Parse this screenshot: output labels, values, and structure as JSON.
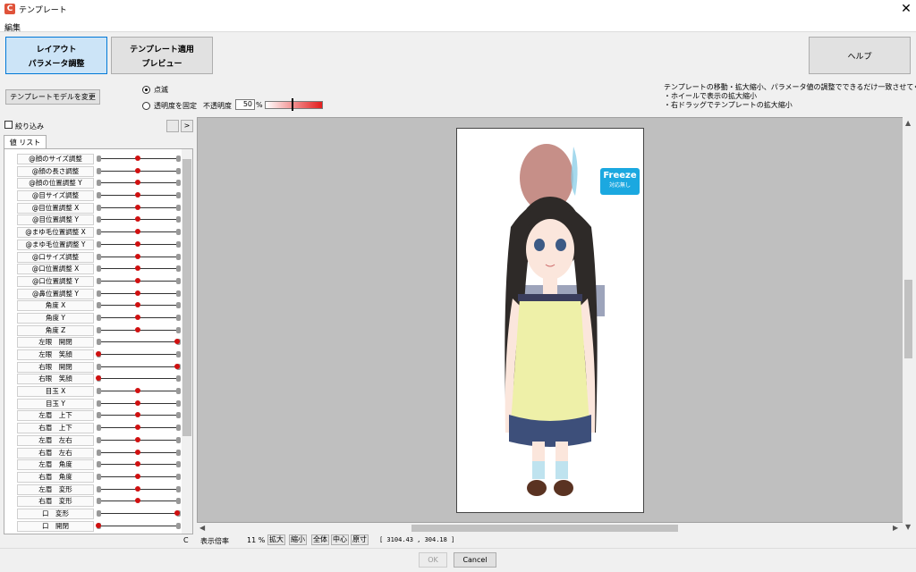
{
  "window": {
    "title": "テンプレート",
    "close_label": "✕"
  },
  "menu": {
    "edit": "編集"
  },
  "mode_buttons": {
    "layout_line1": "レイアウト",
    "layout_line2": "パラメータ調整",
    "template_line1": "テンプレート適用",
    "template_line2": "プレビュー",
    "help": "ヘルプ"
  },
  "change_model_label": "テンプレートモデルを変更",
  "display_options": {
    "blink_label": "点滅",
    "blink_selected": true,
    "fixed_label": "透明度を固定",
    "fixed_selected": false,
    "opacity_label": "不透明度",
    "opacity_value": "50",
    "opacity_unit": "%",
    "opacity_level": 0.5
  },
  "info_lines": [
    "テンプレートの移動・拡大縮小、パラメータ値の調整でできるだけ一致させてください。",
    "・ホイールで表示の拡大縮小",
    "・右ドラッグでテンプレートの拡大縮小"
  ],
  "filter": {
    "label": "絞り込み",
    "button2": ">"
  },
  "list_tab": "値 リスト",
  "parameters": [
    {
      "name": "@顔のサイズ調整",
      "value": 0.5
    },
    {
      "name": "@顔の長さ調整",
      "value": 0.5
    },
    {
      "name": "@顔の位置調整 Y",
      "value": 0.5
    },
    {
      "name": "@目サイズ調整",
      "value": 0.5
    },
    {
      "name": "@目位置調整 X",
      "value": 0.5
    },
    {
      "name": "@目位置調整 Y",
      "value": 0.5
    },
    {
      "name": "@まゆ毛位置調整 X",
      "value": 0.5
    },
    {
      "name": "@まゆ毛位置調整 Y",
      "value": 0.5
    },
    {
      "name": "@口サイズ調整",
      "value": 0.5
    },
    {
      "name": "@口位置調整 X",
      "value": 0.5
    },
    {
      "name": "@口位置調整 Y",
      "value": 0.5
    },
    {
      "name": "@鼻位置調整 Y",
      "value": 0.5
    },
    {
      "name": "角度 X",
      "value": 0.5
    },
    {
      "name": "角度 Y",
      "value": 0.5
    },
    {
      "name": "角度 Z",
      "value": 0.5
    },
    {
      "name": "左眼　開閉",
      "value": 1.0
    },
    {
      "name": "左眼　笑顔",
      "value": 0.0
    },
    {
      "name": "右眼　開閉",
      "value": 1.0
    },
    {
      "name": "右眼　笑顔",
      "value": 0.0
    },
    {
      "name": "目玉 X",
      "value": 0.5
    },
    {
      "name": "目玉 Y",
      "value": 0.5
    },
    {
      "name": "左眉　上下",
      "value": 0.5
    },
    {
      "name": "右眉　上下",
      "value": 0.5
    },
    {
      "name": "左眉　左右",
      "value": 0.5
    },
    {
      "name": "右眉　左右",
      "value": 0.5
    },
    {
      "name": "左眉　角度",
      "value": 0.5
    },
    {
      "name": "右眉　角度",
      "value": 0.5
    },
    {
      "name": "左眉　変形",
      "value": 0.5
    },
    {
      "name": "右眉　変形",
      "value": 0.5
    },
    {
      "name": "口　変形",
      "value": 1.0
    },
    {
      "name": "口　開閉",
      "value": 0.0
    }
  ],
  "list_corner_label": "C",
  "freeze_badge": {
    "title": "Freeze",
    "subtitle": "対応無し"
  },
  "status": {
    "zoom_label": "表示倍率",
    "zoom_value": "11 %",
    "zoom_in": "拡大",
    "zoom_out": "縮小",
    "fit_all": "全体",
    "center": "中心",
    "actual_size": "原寸",
    "coordinates": "[ 3104.43 ,  304.18 ]"
  },
  "footer": {
    "ok_label": "OK",
    "cancel_label": "Cancel"
  },
  "colors": {
    "active_button": "#cce4f7",
    "knob": "#d01010",
    "freeze": "#1ba8e0"
  }
}
